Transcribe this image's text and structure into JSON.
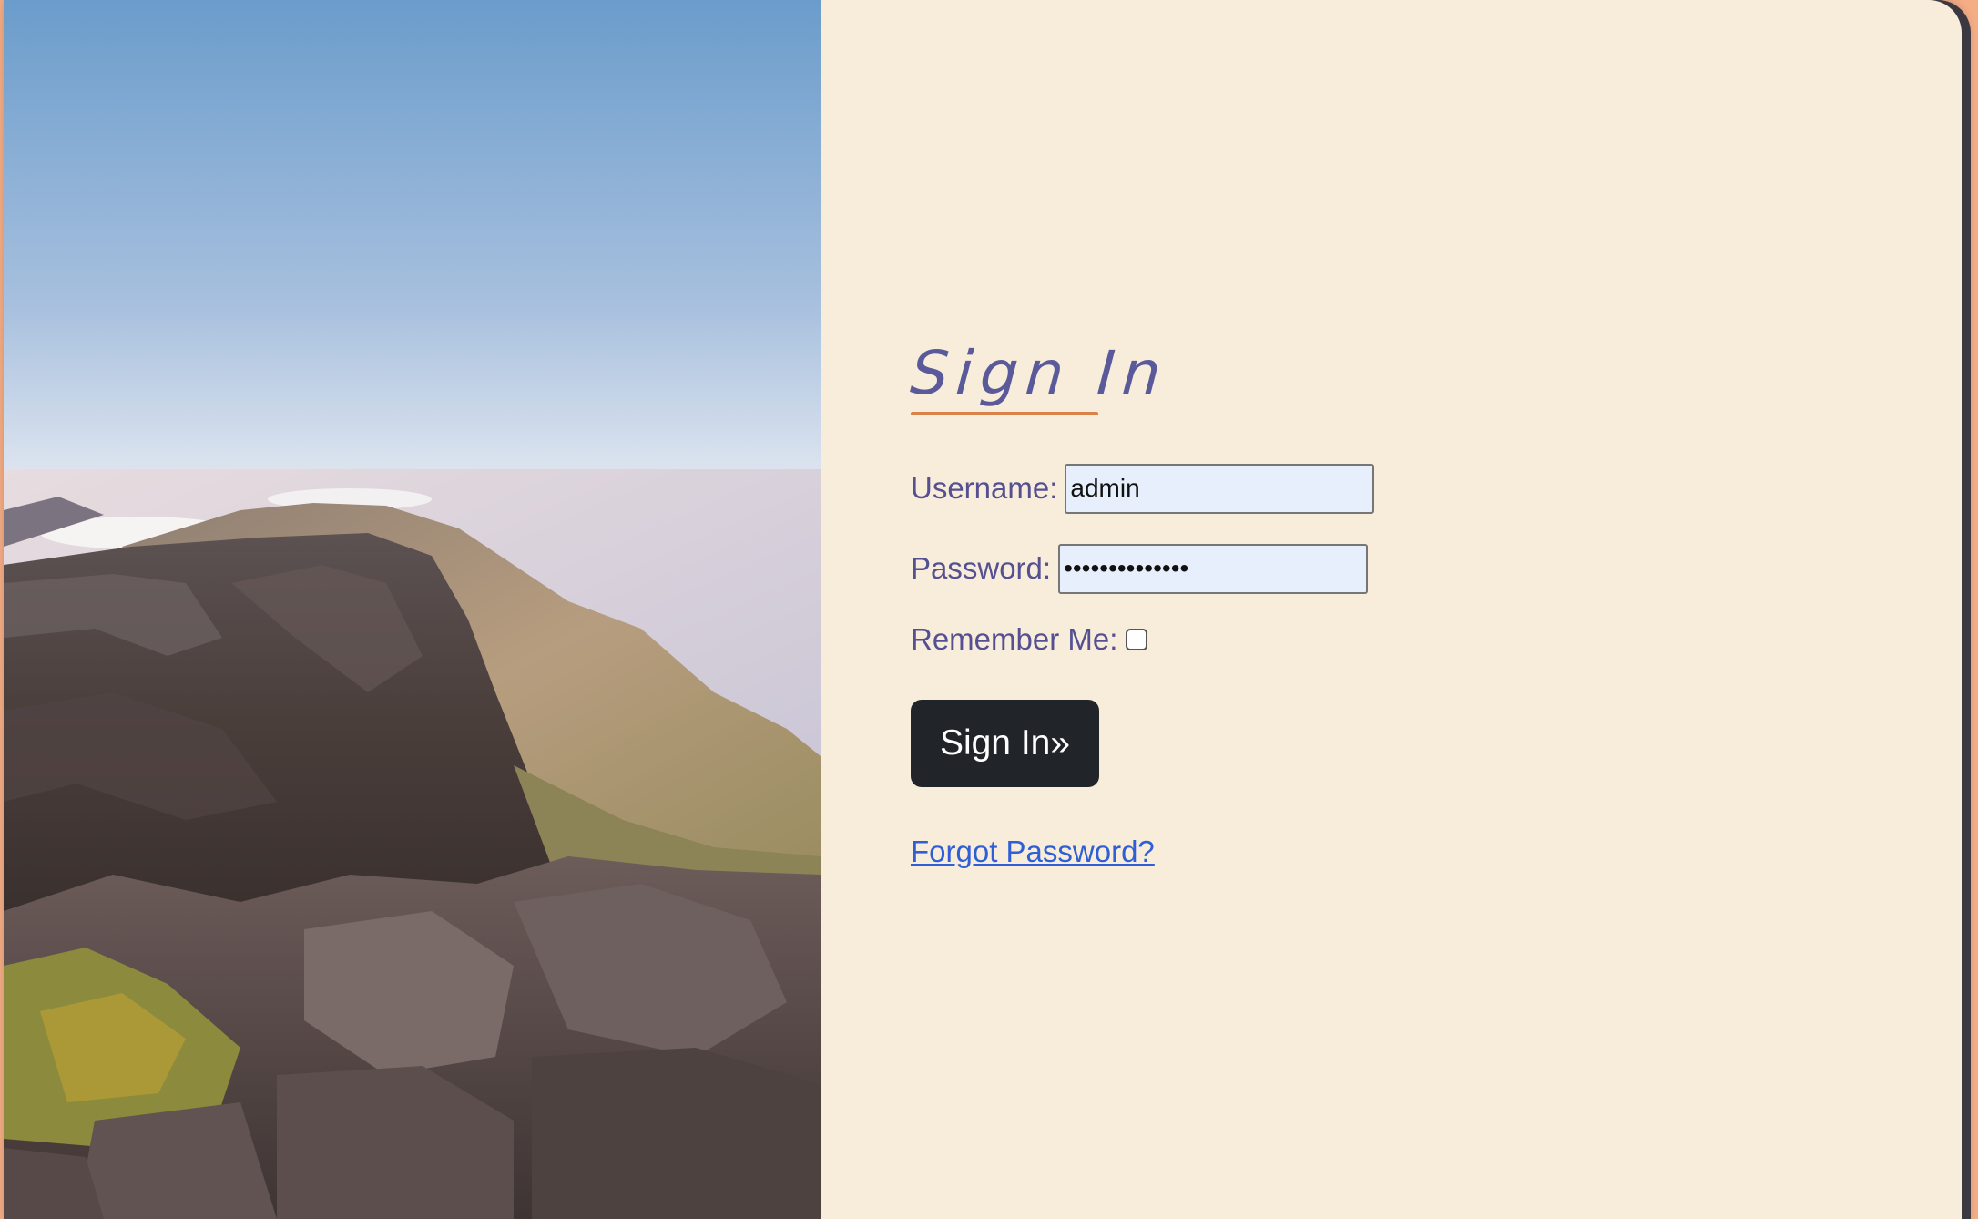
{
  "login": {
    "title": "Sign In",
    "username_label": "Username:",
    "username_value": "admin",
    "password_label": "Password:",
    "password_value": "••••••••••••••",
    "remember_label": "Remember Me:",
    "remember_checked": false,
    "submit_label": "Sign In»",
    "forgot_label": "Forgot Password?"
  },
  "colors": {
    "page_background": "#f8ecda",
    "outer_background": "#f4ad85",
    "label_text": "#545092",
    "title_underline": "#d9824a",
    "button_background": "#212428",
    "link": "#2f5fd6",
    "input_background": "#e7effd"
  },
  "image": {
    "description_icon": "mountain-landscape-photo"
  }
}
